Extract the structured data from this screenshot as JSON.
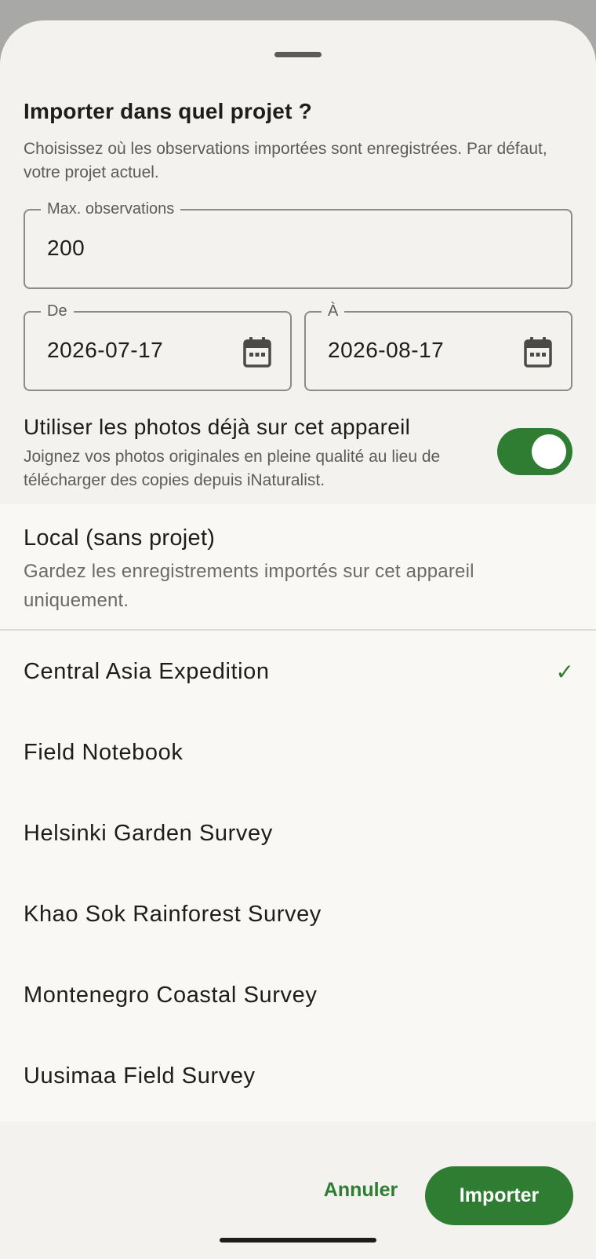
{
  "sheet": {
    "title": "Importer dans quel projet ?",
    "subtitle": "Choisissez où les observations importées sont enregistrées. Par défaut, votre projet actuel."
  },
  "max_field": {
    "label": "Max. observations",
    "value": "200"
  },
  "from_field": {
    "label": "De",
    "value": "2026-07-17",
    "icon": "calendar-icon"
  },
  "to_field": {
    "label": "À",
    "value": "2026-08-17",
    "icon": "calendar-icon"
  },
  "photos_toggle": {
    "title": "Utiliser les photos déjà sur cet appareil",
    "subtitle": "Joignez vos photos originales en pleine qualité au lieu de télécharger des copies depuis iNaturalist.",
    "on": true
  },
  "local_option": {
    "title": "Local (sans projet)",
    "subtitle": "Gardez les enregistrements importés sur cet appareil uniquement."
  },
  "projects": [
    {
      "label": "Central Asia Expedition",
      "selected": true,
      "check": "✓"
    },
    {
      "label": "Field Notebook",
      "selected": false
    },
    {
      "label": "Helsinki Garden Survey",
      "selected": false
    },
    {
      "label": "Khao Sok Rainforest Survey",
      "selected": false
    },
    {
      "label": "Montenegro Coastal Survey",
      "selected": false
    },
    {
      "label": "Uusimaa Field Survey",
      "selected": false
    }
  ],
  "actions": {
    "cancel": "Annuler",
    "import": "Importer"
  },
  "colors": {
    "accent": "#2e7d32",
    "surface": "#f3f2ef",
    "scrim": "#a8a8a6"
  }
}
